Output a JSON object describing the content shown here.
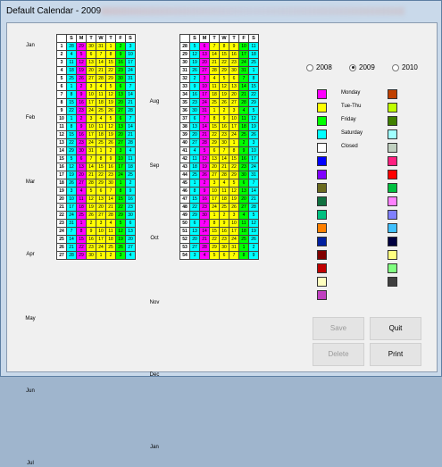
{
  "window": {
    "title": "Default Calendar - 2009"
  },
  "days_header": [
    "S",
    "M",
    "T",
    "W",
    "T",
    "F",
    "S"
  ],
  "month_labels": [
    {
      "name": "Jan",
      "col": 0,
      "row": 1
    },
    {
      "name": "Feb",
      "col": 0,
      "row": 10
    },
    {
      "name": "Mar",
      "col": 0,
      "row": 18
    },
    {
      "name": "Apr",
      "col": 0,
      "row": 27
    },
    {
      "name": "May",
      "col": 0,
      "row": 35
    },
    {
      "name": "Jun",
      "col": 0,
      "row": 44
    },
    {
      "name": "Jul",
      "col": 0,
      "row": 53
    },
    {
      "name": "Aug",
      "col": 1,
      "row": 8
    },
    {
      "name": "Sep",
      "col": 1,
      "row": 16
    },
    {
      "name": "Oct",
      "col": 1,
      "row": 25
    },
    {
      "name": "Nov",
      "col": 1,
      "row": 33
    },
    {
      "name": "Dec",
      "col": 1,
      "row": 42
    },
    {
      "name": "Jan",
      "col": 1,
      "row": 51
    }
  ],
  "calendar_left": [
    [
      "1",
      "28",
      "29",
      "30",
      "31",
      "1",
      "2",
      "3"
    ],
    [
      "2",
      "4",
      "5",
      "6",
      "7",
      "8",
      "9",
      "10"
    ],
    [
      "3",
      "11",
      "12",
      "13",
      "14",
      "15",
      "16",
      "17"
    ],
    [
      "4",
      "18",
      "19",
      "20",
      "21",
      "22",
      "23",
      "24"
    ],
    [
      "5",
      "25",
      "26",
      "27",
      "28",
      "29",
      "30",
      "31"
    ],
    [
      "6",
      "1",
      "2",
      "3",
      "4",
      "5",
      "6",
      "7"
    ],
    [
      "7",
      "8",
      "9",
      "10",
      "11",
      "12",
      "13",
      "14"
    ],
    [
      "8",
      "15",
      "16",
      "17",
      "18",
      "19",
      "20",
      "21"
    ],
    [
      "9",
      "22",
      "23",
      "24",
      "25",
      "26",
      "27",
      "28"
    ],
    [
      "10",
      "1",
      "2",
      "3",
      "4",
      "5",
      "6",
      "7"
    ],
    [
      "11",
      "8",
      "9",
      "10",
      "11",
      "12",
      "13",
      "14"
    ],
    [
      "12",
      "15",
      "16",
      "17",
      "18",
      "19",
      "20",
      "21"
    ],
    [
      "13",
      "22",
      "23",
      "24",
      "25",
      "26",
      "27",
      "28"
    ],
    [
      "14",
      "29",
      "30",
      "31",
      "1",
      "2",
      "3",
      "4"
    ],
    [
      "15",
      "5",
      "6",
      "7",
      "8",
      "9",
      "10",
      "11"
    ],
    [
      "16",
      "12",
      "13",
      "14",
      "15",
      "16",
      "17",
      "18"
    ],
    [
      "17",
      "19",
      "20",
      "21",
      "22",
      "23",
      "24",
      "25"
    ],
    [
      "18",
      "26",
      "27",
      "28",
      "29",
      "30",
      "1",
      "2"
    ],
    [
      "19",
      "3",
      "4",
      "5",
      "6",
      "7",
      "8",
      "9"
    ],
    [
      "20",
      "10",
      "11",
      "12",
      "13",
      "14",
      "15",
      "16"
    ],
    [
      "21",
      "17",
      "18",
      "19",
      "20",
      "21",
      "22",
      "23"
    ],
    [
      "22",
      "24",
      "25",
      "26",
      "27",
      "28",
      "29",
      "30"
    ],
    [
      "23",
      "31",
      "1",
      "2",
      "3",
      "4",
      "5",
      "6"
    ],
    [
      "24",
      "7",
      "8",
      "9",
      "10",
      "11",
      "12",
      "13"
    ],
    [
      "25",
      "14",
      "15",
      "16",
      "17",
      "18",
      "19",
      "20"
    ],
    [
      "26",
      "21",
      "22",
      "23",
      "24",
      "25",
      "26",
      "27"
    ],
    [
      "27",
      "28",
      "29",
      "30",
      "1",
      "2",
      "3",
      "4"
    ]
  ],
  "calendar_left_extra": [
    "18",
    "19",
    "21",
    "22",
    "23",
    "24",
    "25"
  ],
  "calendar_right": [
    [
      "28",
      "5",
      "6",
      "7",
      "8",
      "9",
      "10",
      "11"
    ],
    [
      "29",
      "12",
      "13",
      "14",
      "15",
      "16",
      "17",
      "18"
    ],
    [
      "30",
      "19",
      "20",
      "21",
      "22",
      "23",
      "24",
      "25"
    ],
    [
      "31",
      "26",
      "27",
      "28",
      "29",
      "30",
      "31",
      "1"
    ],
    [
      "32",
      "2",
      "3",
      "4",
      "5",
      "6",
      "7",
      "8"
    ],
    [
      "33",
      "9",
      "10",
      "11",
      "12",
      "13",
      "14",
      "15"
    ],
    [
      "34",
      "16",
      "17",
      "18",
      "19",
      "20",
      "21",
      "22"
    ],
    [
      "35",
      "23",
      "24",
      "25",
      "26",
      "27",
      "28",
      "29"
    ],
    [
      "36",
      "30",
      "31",
      "1",
      "2",
      "3",
      "4",
      "5"
    ],
    [
      "37",
      "6",
      "7",
      "8",
      "9",
      "10",
      "11",
      "12"
    ],
    [
      "38",
      "13",
      "14",
      "15",
      "16",
      "17",
      "18",
      "19"
    ],
    [
      "39",
      "20",
      "21",
      "22",
      "23",
      "24",
      "25",
      "26"
    ],
    [
      "40",
      "27",
      "28",
      "29",
      "30",
      "1",
      "2",
      "3"
    ],
    [
      "41",
      "4",
      "5",
      "6",
      "7",
      "8",
      "9",
      "10"
    ],
    [
      "42",
      "11",
      "12",
      "13",
      "14",
      "15",
      "16",
      "17"
    ],
    [
      "43",
      "18",
      "19",
      "20",
      "21",
      "22",
      "23",
      "24"
    ],
    [
      "44",
      "25",
      "26",
      "27",
      "28",
      "29",
      "30",
      "31"
    ],
    [
      "45",
      "1",
      "2",
      "3",
      "4",
      "5",
      "6",
      "7"
    ],
    [
      "46",
      "8",
      "9",
      "10",
      "11",
      "12",
      "13",
      "14"
    ],
    [
      "47",
      "15",
      "16",
      "17",
      "18",
      "19",
      "20",
      "21"
    ],
    [
      "48",
      "22",
      "23",
      "24",
      "25",
      "26",
      "27",
      "28"
    ],
    [
      "49",
      "29",
      "30",
      "1",
      "2",
      "3",
      "4",
      "5"
    ],
    [
      "50",
      "6",
      "7",
      "8",
      "9",
      "10",
      "11",
      "12"
    ],
    [
      "51",
      "13",
      "14",
      "15",
      "16",
      "17",
      "18",
      "19"
    ],
    [
      "52",
      "20",
      "21",
      "22",
      "23",
      "24",
      "25",
      "26"
    ],
    [
      "53",
      "27",
      "28",
      "29",
      "30",
      "31",
      "1",
      "2"
    ],
    [
      "54",
      "3",
      "4",
      "5",
      "6",
      "7",
      "8",
      "9"
    ]
  ],
  "day_colors": {
    "sun": "#00ffff",
    "mon": "#ff00ff",
    "weekday": "#ffff00",
    "sat": "#00ff00",
    "closed": "#ffffff"
  },
  "years": [
    {
      "label": "2008",
      "selected": false
    },
    {
      "label": "2009",
      "selected": true
    },
    {
      "label": "2010",
      "selected": false
    }
  ],
  "legend": [
    {
      "label": "Monday",
      "color": "#ff00ff"
    },
    {
      "label": "Tue-Thu",
      "color": "#ffff00"
    },
    {
      "label": "Friday",
      "color": "#00ff00"
    },
    {
      "label": "Saturday",
      "color": "#00ffff"
    },
    {
      "label": "Closed",
      "color": "#ffffff"
    }
  ],
  "palette_left": [
    "#ff00ff",
    "#ffff00",
    "#00ff00",
    "#00ffff",
    "#ffffff",
    "#0000ff",
    "#8000ff",
    "#6b6b20",
    "#107040",
    "#00c080",
    "#ff8000",
    "#0020a0",
    "#800000",
    "#c00000",
    "#ffffc0",
    "#c040c0"
  ],
  "palette_right": [
    "#c04000",
    "#c0ff00",
    "#408000",
    "#a0ffff",
    "#c0d0c0",
    "#ff2080",
    "#ff0000",
    "#00c040",
    "#ff80ff",
    "#8080ff",
    "#40c0ff",
    "#000040",
    "#ffff80",
    "#80ff80",
    "#404040"
  ],
  "buttons": {
    "save": "Save",
    "quit": "Quit",
    "delete": "Delete",
    "print": "Print"
  }
}
